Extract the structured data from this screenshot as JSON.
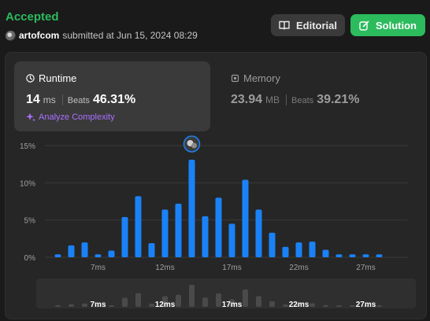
{
  "header": {
    "status": "Accepted",
    "username": "artofcom",
    "submitted_text": "submitted at Jun 15, 2024 08:29",
    "editorial_label": "Editorial",
    "solution_label": "Solution"
  },
  "runtime": {
    "title": "Runtime",
    "value": "14",
    "unit": "ms",
    "beats_label": "Beats",
    "beats_pct": "46.31%",
    "analyze_label": "Analyze Complexity"
  },
  "memory": {
    "title": "Memory",
    "value": "23.94",
    "unit": "MB",
    "beats_label": "Beats",
    "beats_pct": "39.21%"
  },
  "colors": {
    "accepted": "#2cbb5d",
    "bar": "#1a82f7",
    "analyze": "#a970ff"
  },
  "chart_data": {
    "type": "bar",
    "x": [
      4,
      5,
      6,
      7,
      8,
      9,
      10,
      11,
      12,
      13,
      14,
      15,
      16,
      17,
      18,
      19,
      20,
      21,
      22,
      23,
      24,
      25,
      26,
      27,
      28
    ],
    "values": [
      0.4,
      1.6,
      2.0,
      0.4,
      0.9,
      5.4,
      8.2,
      1.9,
      6.4,
      7.2,
      13.1,
      5.5,
      8.0,
      4.5,
      10.4,
      6.4,
      3.3,
      1.4,
      2.0,
      2.1,
      1.0,
      0.4,
      0.4,
      0.4,
      0.4
    ],
    "user_x": 14,
    "ylim": [
      0,
      15
    ],
    "yticks": [
      0,
      5,
      10,
      15
    ],
    "ytick_labels": [
      "0%",
      "5%",
      "10%",
      "15%"
    ],
    "xtick_values": [
      7,
      12,
      17,
      22,
      27
    ],
    "xtick_labels": [
      "7ms",
      "12ms",
      "17ms",
      "22ms",
      "27ms"
    ],
    "grid": true
  }
}
